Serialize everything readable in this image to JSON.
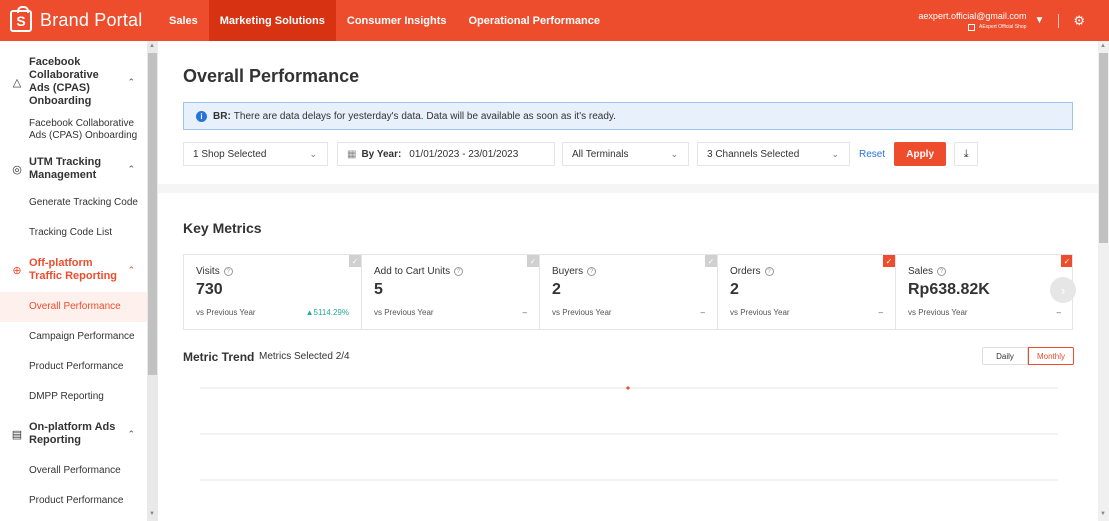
{
  "brand": {
    "name": "Brand Portal",
    "logo_letter": "S"
  },
  "nav": [
    {
      "label": "Sales"
    },
    {
      "label": "Marketing Solutions"
    },
    {
      "label": "Consumer Insights"
    },
    {
      "label": "Operational Performance"
    }
  ],
  "account": {
    "email": "aexpert.official@gmail.com",
    "shop": "AExpert Official Shop"
  },
  "sidebar": {
    "groups": [
      {
        "label": "Facebook Collaborative Ads (CPAS) Onboarding",
        "icon": "triangle-icon",
        "items": [
          "Facebook Collaborative Ads (CPAS) Onboarding"
        ]
      },
      {
        "label": "UTM Tracking Management",
        "icon": "target-icon",
        "items": [
          "Generate Tracking Code",
          "Tracking Code List"
        ]
      },
      {
        "label": "Off-platform Traffic Reporting",
        "icon": "plus-circle-icon",
        "items": [
          "Overall Performance",
          "Campaign Performance",
          "Product Performance",
          "DMPP Reporting"
        ]
      },
      {
        "label": "On-platform Ads Reporting",
        "icon": "ads-icon",
        "items": [
          "Overall Performance",
          "Product Performance"
        ]
      }
    ]
  },
  "page": {
    "title": "Overall Performance"
  },
  "notice": {
    "prefix": "BR:",
    "text": "There are data delays for yesterday's data. Data will be available as soon as it's ready."
  },
  "filters": {
    "shop": "1 Shop Selected",
    "period_label": "By Year:",
    "period_value": "01/01/2023 - 23/01/2023",
    "terminals": "All Terminals",
    "channels": "3 Channels Selected",
    "reset": "Reset",
    "apply": "Apply"
  },
  "key_metrics": {
    "title": "Key Metrics",
    "items": [
      {
        "name": "Visits",
        "value": "730",
        "compare": "vs Previous Year",
        "change": "▲5114.29%",
        "checked": false
      },
      {
        "name": "Add to Cart Units",
        "value": "5",
        "compare": "vs Previous Year",
        "change": "–",
        "checked": false
      },
      {
        "name": "Buyers",
        "value": "2",
        "compare": "vs Previous Year",
        "change": "–",
        "checked": false
      },
      {
        "name": "Orders",
        "value": "2",
        "compare": "vs Previous Year",
        "change": "–",
        "checked": true
      },
      {
        "name": "Sales",
        "value": "Rp638.82K",
        "compare": "vs Previous Year",
        "change": "–",
        "checked": true
      }
    ]
  },
  "trend": {
    "title": "Metric Trend",
    "subtitle": "Metrics Selected 2/4",
    "daily": "Daily",
    "monthly": "Monthly"
  },
  "colors": {
    "accent": "#ee4d2d",
    "nav_active": "#d73211",
    "info": "#2673dd",
    "up": "#26aa99"
  }
}
